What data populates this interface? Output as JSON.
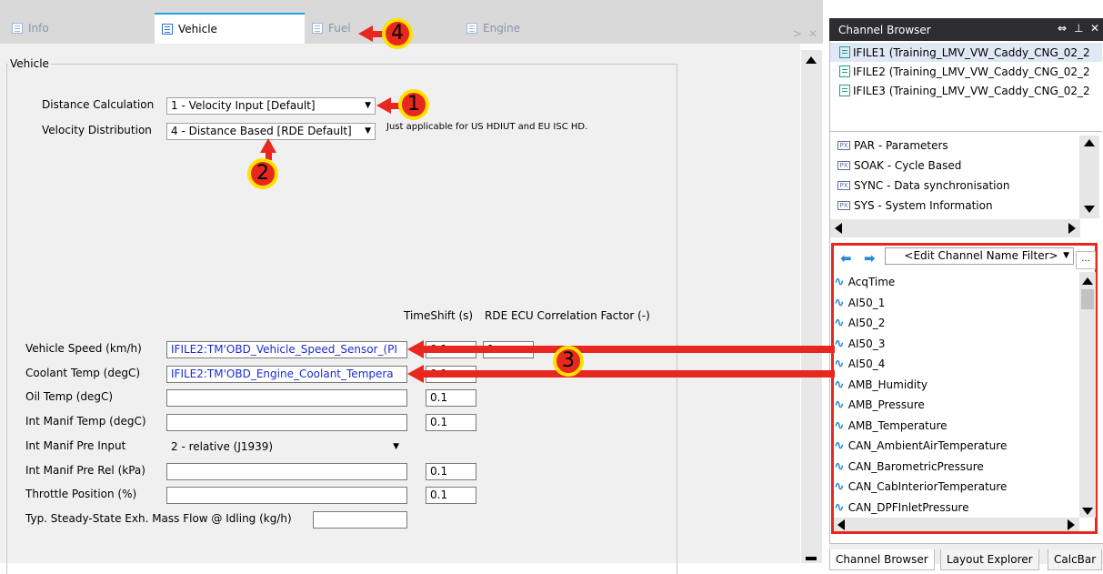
{
  "tabs": [
    {
      "label": "Info",
      "active": false
    },
    {
      "label": "Vehicle",
      "active": true
    },
    {
      "label": "Fuel",
      "active": false
    },
    {
      "label": "Engine",
      "active": false
    }
  ],
  "group_label": "Vehicle",
  "distance_calc": {
    "label": "Distance Calculation",
    "value": "1 - Velocity Input [Default]"
  },
  "velocity_dist": {
    "label": "Velocity Distribution",
    "value": "4 - Distance Based [RDE Default]",
    "note": "Just applicable for US HDIUT and EU ISC HD."
  },
  "columns": {
    "timeshift": "TimeShift (s)",
    "rde_factor": "RDE ECU Correlation Factor (-)"
  },
  "fields": [
    {
      "label": "Vehicle Speed (km/h)",
      "value": "IFILE2:TM'OBD_Vehicle_Speed_Sensor_(PI",
      "timeshift": "0.1",
      "factor": "1"
    },
    {
      "label": "Coolant Temp (degC)",
      "value": "IFILE2:TM'OBD_Engine_Coolant_Tempera",
      "timeshift": "0.1",
      "factor": ""
    },
    {
      "label": "Oil Temp (degC)",
      "value": "",
      "timeshift": "0.1",
      "factor": ""
    },
    {
      "label": "Int Manif Temp (degC)",
      "value": "",
      "timeshift": "0.1",
      "factor": ""
    },
    {
      "label": "Int Manif Pre Input",
      "value": "2 - relative (J1939)",
      "timeshift": "",
      "factor": ""
    },
    {
      "label": "Int Manif Pre Rel (kPa)",
      "value": "",
      "timeshift": "0.1",
      "factor": ""
    },
    {
      "label": "Throttle Position (%)",
      "value": "",
      "timeshift": "0.1",
      "factor": ""
    },
    {
      "label": "Typ. Steady-State Exh. Mass Flow @ Idling (kg/h)",
      "value": "",
      "timeshift": "",
      "factor": ""
    }
  ],
  "channel_browser": {
    "title": "Channel Browser",
    "files": [
      "IFILE1 (Training_LMV_VW_Caddy_CNG_02_2",
      "IFILE2 (Training_LMV_VW_Caddy_CNG_02_2",
      "IFILE3 (Training_LMV_VW_Caddy_CNG_02_2"
    ],
    "groups": [
      {
        "label": "PAR - Parameters",
        "icon": "parameter-group-icon"
      },
      {
        "label": "SOAK - Cycle Based",
        "icon": "cycle-group-icon"
      },
      {
        "label": "SYNC - Data synchronisation",
        "icon": "sync-group-icon"
      },
      {
        "label": "SYS - System Information",
        "icon": "system-group-icon"
      }
    ],
    "filter_placeholder": "<Edit Channel Name Filter>",
    "filter_more": "...",
    "channels": [
      "AcqTime",
      "AI50_1",
      "AI50_2",
      "AI50_3",
      "AI50_4",
      "AMB_Humidity",
      "AMB_Pressure",
      "AMB_Temperature",
      "CAN_AmbientAirTemperature",
      "CAN_BarometricPressure",
      "CAN_CabInteriorTemperature",
      "CAN_DPFInletPressure"
    ],
    "bottom_tabs": [
      "Channel Browser",
      "Layout Explorer",
      "CalcBar"
    ]
  },
  "annotations": [
    "1",
    "2",
    "3",
    "4"
  ],
  "colors": {
    "annotation_red": "#e8281f",
    "annotation_yellow": "#ffe100",
    "bound_value_blue": "#1a2bd6",
    "active_tab_accent": "#27a0e2"
  }
}
